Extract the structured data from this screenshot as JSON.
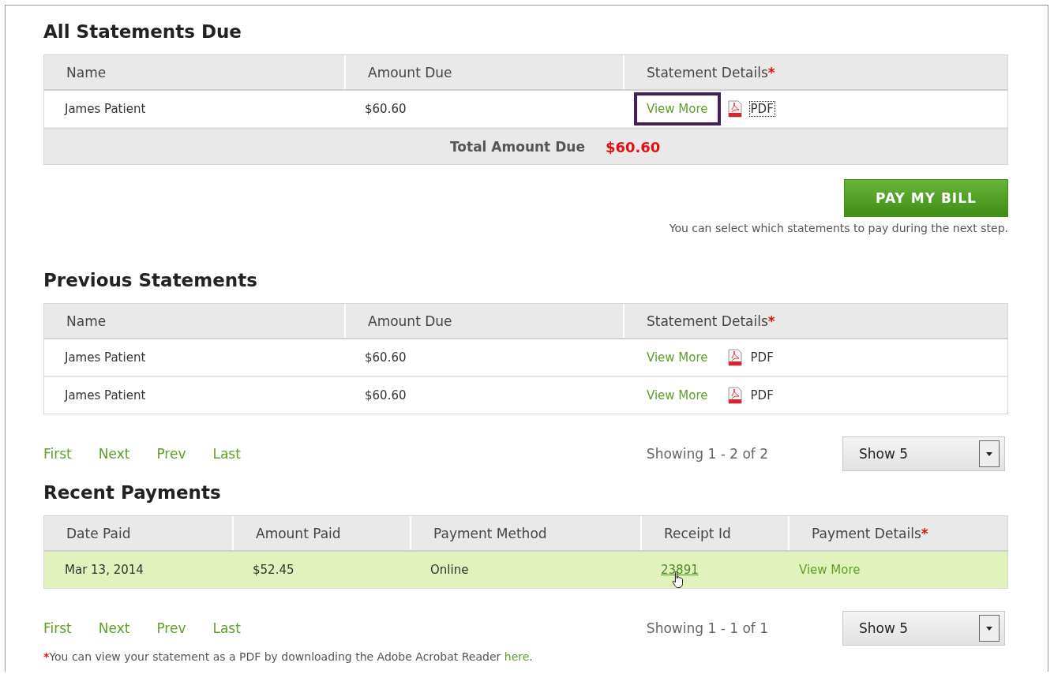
{
  "due": {
    "title": "All Statements Due",
    "columns": [
      {
        "label": "Name"
      },
      {
        "label": "Amount Due"
      },
      {
        "label": "Statement Details",
        "mark": "*"
      }
    ],
    "rows": [
      {
        "name": "James Patient",
        "amount": "$60.60",
        "link": "View More",
        "link_focused": true,
        "pdf": "PDF",
        "pdf_focused": true
      }
    ],
    "total_label": "Total Amount Due",
    "total_value": "$60.60"
  },
  "pay": {
    "button": "PAY MY BILL",
    "note": "You can select which statements to pay during the next step."
  },
  "previous": {
    "title": "Previous Statements",
    "columns": [
      {
        "label": "Name"
      },
      {
        "label": "Amount Due"
      },
      {
        "label": "Statement Details",
        "mark": "*"
      }
    ],
    "rows": [
      {
        "name": "James Patient",
        "amount": "$60.60",
        "link": "View More",
        "link_focused": false,
        "pdf": "PDF",
        "pdf_focused": false
      },
      {
        "name": "James Patient",
        "amount": "$60.60",
        "link": "View More",
        "link_focused": false,
        "pdf": "PDF",
        "pdf_focused": false
      }
    ],
    "pager": {
      "links": [
        "First",
        "Next",
        "Prev",
        "Last"
      ],
      "showing": "Showing 1 - 2 of 2",
      "page_size": "Show 5"
    }
  },
  "recent": {
    "title": "Recent Payments",
    "columns": [
      {
        "label": "Date Paid"
      },
      {
        "label": "Amount Paid"
      },
      {
        "label": "Payment Method"
      },
      {
        "label": "Receipt Id"
      },
      {
        "label": "Payment Details",
        "mark": "*"
      }
    ],
    "rows": [
      {
        "date": "Mar 13, 2014",
        "amount": "$52.45",
        "method": "Online",
        "receipt": "23891",
        "link": "View More",
        "selected": true,
        "hovered": true
      }
    ],
    "pager": {
      "links": [
        "First",
        "Next",
        "Prev",
        "Last"
      ],
      "showing": "Showing 1 - 1 of 1",
      "page_size": "Show 5"
    }
  },
  "footnote": {
    "mark": "*",
    "text": "You can view your statement as a PDF by downloading the Adobe Acrobat Reader",
    "link": "here",
    "end": "."
  }
}
